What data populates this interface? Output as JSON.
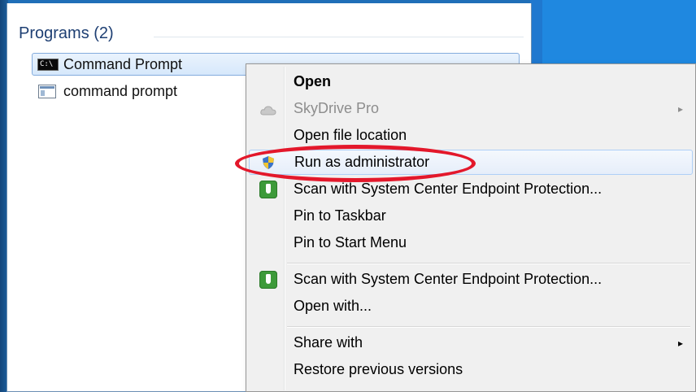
{
  "start_menu": {
    "section_header": "Programs (2)",
    "results": [
      {
        "label": "Command Prompt",
        "icon": "cmd-icon",
        "selected": true
      },
      {
        "label": "command prompt",
        "icon": "document-icon",
        "selected": false
      }
    ]
  },
  "context_menu": {
    "items": [
      {
        "label": "Open",
        "bold": true
      },
      {
        "label": "SkyDrive Pro",
        "disabled": true,
        "submenu": true,
        "icon": "cloud-icon"
      },
      {
        "label": "Open file location"
      },
      {
        "label": "Run as administrator",
        "hover": true,
        "icon": "uac-shield-icon"
      },
      {
        "label": "Scan with System Center Endpoint Protection...",
        "icon": "endpoint-protection-icon"
      },
      {
        "label": "Pin to Taskbar"
      },
      {
        "label": "Pin to Start Menu"
      },
      {
        "label": "Scan with System Center Endpoint Protection...",
        "icon": "endpoint-protection-icon"
      },
      {
        "label": "Open with..."
      },
      {
        "label": "Share with",
        "submenu": true
      },
      {
        "label": "Restore previous versions"
      }
    ],
    "submenu_glyph": "▸"
  },
  "colors": {
    "highlight_ring": "#e3182b",
    "selection_border": "#84acdd",
    "header_text": "#1e3f73"
  }
}
